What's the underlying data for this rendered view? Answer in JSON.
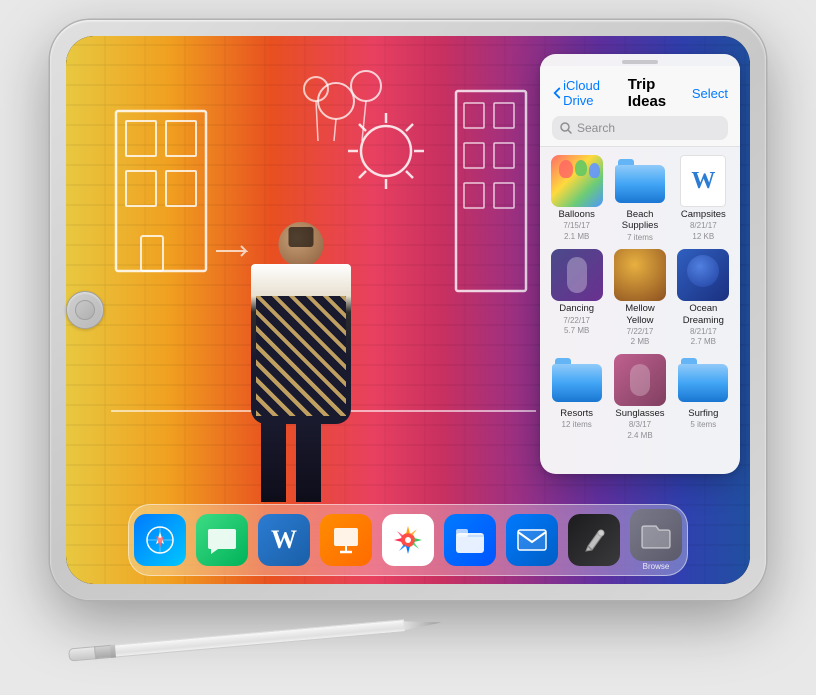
{
  "scene": {
    "background_color": "#e8e8e8"
  },
  "ipad": {
    "frame_color": "#d0d0d0"
  },
  "panel": {
    "back_label": "iCloud Drive",
    "title": "Trip Ideas",
    "select_label": "Select",
    "search_placeholder": "Search",
    "files": [
      {
        "id": "balloons",
        "name": "Balloons",
        "meta": "7/15/17\n2.1 MB",
        "type": "image",
        "thumb_class": "file-thumb-balloon"
      },
      {
        "id": "beach-supplies",
        "name": "Beach Supplies",
        "meta": "7 items",
        "type": "folder",
        "thumb_class": ""
      },
      {
        "id": "campsites",
        "name": "Campsites",
        "meta": "8/21/17\n12 KB",
        "type": "word",
        "thumb_class": "file-thumb-word"
      },
      {
        "id": "dancing",
        "name": "Dancing",
        "meta": "7/22/17\n5.7 MB",
        "type": "image",
        "thumb_class": "file-thumb-dancing"
      },
      {
        "id": "mellow-yellow",
        "name": "Mellow Yellow",
        "meta": "7/22/17\n2 MB",
        "type": "image",
        "thumb_class": "file-thumb-mellow"
      },
      {
        "id": "ocean-dreaming",
        "name": "Ocean Dreaming",
        "meta": "8/21/17\n2.7 MB",
        "type": "image",
        "thumb_class": "file-thumb-ocean"
      },
      {
        "id": "resorts",
        "name": "Resorts",
        "meta": "12 items",
        "type": "folder",
        "thumb_class": ""
      },
      {
        "id": "sunglasses",
        "name": "Sunglasses",
        "meta": "8/3/17\n2.4 MB",
        "type": "image",
        "thumb_class": "file-thumb-sunglasses"
      },
      {
        "id": "surfing",
        "name": "Surfing",
        "meta": "5 items",
        "type": "folder",
        "thumb_class": ""
      }
    ]
  },
  "dock": {
    "icons": [
      {
        "id": "safari",
        "label": "",
        "emoji": "🧭",
        "css_class": "icon-safari"
      },
      {
        "id": "messages",
        "label": "",
        "emoji": "💬",
        "css_class": "icon-messages"
      },
      {
        "id": "word",
        "label": "",
        "emoji": "W",
        "css_class": "icon-word"
      },
      {
        "id": "keynote",
        "label": "",
        "emoji": "▶",
        "css_class": "icon-keynote"
      },
      {
        "id": "photos",
        "label": "",
        "emoji": "🌸",
        "css_class": "icon-photos"
      },
      {
        "id": "files",
        "label": "",
        "emoji": "📁",
        "css_class": "icon-files"
      },
      {
        "id": "mail",
        "label": "",
        "emoji": "✉",
        "css_class": "icon-mail"
      },
      {
        "id": "pencil",
        "label": "",
        "emoji": "✏",
        "css_class": "icon-pencil-app"
      },
      {
        "id": "browse",
        "label": "Browse",
        "emoji": "📂",
        "css_class": "icon-browse"
      }
    ]
  },
  "pencil": {
    "label": "Apple Pencil"
  }
}
